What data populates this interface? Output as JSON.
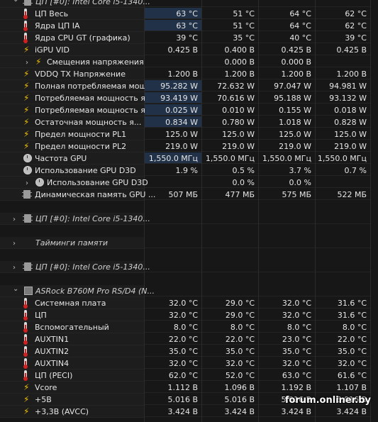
{
  "rows": [
    {
      "kind": "sensor",
      "indent": 0,
      "icon": "chip-icon",
      "name": "ЦП [#0]: Intel Core i5-1340...",
      "v": [
        "",
        "",
        "",
        ""
      ],
      "hl": [
        false,
        false,
        false,
        false
      ],
      "italic": true,
      "partial": true
    },
    {
      "kind": "sensor",
      "indent": 1,
      "icon": "thermometer-icon",
      "name": "ЦП Весь",
      "v": [
        "63 °C",
        "51 °C",
        "64 °C",
        "62 °C"
      ],
      "hl": [
        true,
        false,
        false,
        false
      ]
    },
    {
      "kind": "sensor",
      "indent": 1,
      "icon": "thermometer-icon",
      "name": "Ядра ЦП IA",
      "v": [
        "63 °C",
        "51 °C",
        "64 °C",
        "62 °C"
      ],
      "hl": [
        true,
        false,
        false,
        false
      ]
    },
    {
      "kind": "sensor",
      "indent": 1,
      "icon": "thermometer-icon",
      "name": "Ядра CPU GT (графика)",
      "v": [
        "39 °C",
        "35 °C",
        "40 °C",
        "39 °C"
      ],
      "hl": [
        false,
        false,
        false,
        false
      ]
    },
    {
      "kind": "sensor",
      "indent": 1,
      "icon": "bolt-icon",
      "name": "iGPU VID",
      "v": [
        "0.425 В",
        "0.400 В",
        "0.425 В",
        "0.425 В"
      ],
      "hl": [
        false,
        false,
        false,
        false
      ]
    },
    {
      "kind": "sensor",
      "indent": 2,
      "icon": "bolt-icon",
      "chev": true,
      "name": "Смещения напряжения",
      "v": [
        "",
        "0.000 В",
        "0.000 В",
        ""
      ],
      "hl": [
        false,
        false,
        false,
        false
      ]
    },
    {
      "kind": "sensor",
      "indent": 1,
      "icon": "bolt-icon",
      "name": "VDDQ TX Напряжение",
      "v": [
        "1.200 В",
        "1.200 В",
        "1.200 В",
        "1.200 В"
      ],
      "hl": [
        false,
        false,
        false,
        false
      ]
    },
    {
      "kind": "sensor",
      "indent": 1,
      "icon": "bolt-icon",
      "name": "Полная потребляемая мощ...",
      "v": [
        "95.282 W",
        "72.632 W",
        "97.047 W",
        "94.981 W"
      ],
      "hl": [
        true,
        false,
        false,
        false
      ]
    },
    {
      "kind": "sensor",
      "indent": 1,
      "icon": "bolt-icon",
      "name": "Потребляемая мощность я...",
      "v": [
        "93.419 W",
        "70.616 W",
        "95.188 W",
        "93.132 W"
      ],
      "hl": [
        true,
        false,
        false,
        false
      ]
    },
    {
      "kind": "sensor",
      "indent": 1,
      "icon": "bolt-icon",
      "name": "Потребляемая мощность я...",
      "v": [
        "0.025 W",
        "0.010 W",
        "0.155 W",
        "0.018 W"
      ],
      "hl": [
        true,
        false,
        false,
        false
      ]
    },
    {
      "kind": "sensor",
      "indent": 1,
      "icon": "bolt-icon",
      "name": "Остаточная мощность я...",
      "v": [
        "0.834 W",
        "0.780 W",
        "1.018 W",
        "0.828 W"
      ],
      "hl": [
        true,
        false,
        false,
        false
      ]
    },
    {
      "kind": "sensor",
      "indent": 1,
      "icon": "bolt-icon",
      "name": "Предел мощности PL1",
      "v": [
        "125.0 W",
        "125.0 W",
        "125.0 W",
        "125.0 W"
      ],
      "hl": [
        false,
        false,
        false,
        false
      ]
    },
    {
      "kind": "sensor",
      "indent": 1,
      "icon": "bolt-icon",
      "name": "Предел мощности PL2",
      "v": [
        "219.0 W",
        "219.0 W",
        "219.0 W",
        "219.0 W"
      ],
      "hl": [
        false,
        false,
        false,
        false
      ]
    },
    {
      "kind": "sensor",
      "indent": 1,
      "icon": "clock-icon",
      "name": "Частота GPU",
      "v": [
        "1,550.0 МГц",
        "1,550.0 МГц",
        "1,550.0 МГц",
        "1,550.0 МГц"
      ],
      "hl": [
        true,
        false,
        false,
        false
      ]
    },
    {
      "kind": "sensor",
      "indent": 1,
      "icon": "clock-icon",
      "name": "Использование GPU D3D",
      "v": [
        "1.9 %",
        "0.5 %",
        "3.7 %",
        "0.7 %"
      ],
      "hl": [
        false,
        false,
        false,
        false
      ]
    },
    {
      "kind": "sensor",
      "indent": 2,
      "icon": "clock-icon",
      "chev": true,
      "name": "Использование GPU D3D",
      "v": [
        "",
        "0.0 %",
        "0.0 %",
        ""
      ],
      "hl": [
        false,
        false,
        false,
        false
      ]
    },
    {
      "kind": "sensor",
      "indent": 1,
      "icon": "chip-icon",
      "name": "Динамическая память GPU ...",
      "v": [
        "507 МБ",
        "477 МБ",
        "575 МБ",
        "522 МБ"
      ],
      "hl": [
        false,
        false,
        false,
        false
      ]
    },
    {
      "kind": "empty"
    },
    {
      "kind": "group",
      "icon": "chip-icon",
      "name": "ЦП [#0]: Intel Core i5-1340..."
    },
    {
      "kind": "empty"
    },
    {
      "kind": "group",
      "icon": "",
      "name": "Тайминги памяти"
    },
    {
      "kind": "empty"
    },
    {
      "kind": "group",
      "icon": "chip-icon",
      "name": "ЦП [#0]: Intel Core i5-1340..."
    },
    {
      "kind": "empty"
    },
    {
      "kind": "group",
      "icon": "board-icon",
      "name": "ASRock B760M Pro RS/D4 (N...",
      "open": true
    },
    {
      "kind": "sensor",
      "indent": 1,
      "icon": "thermometer-icon",
      "name": "Системная плата",
      "v": [
        "32.0 °C",
        "29.0 °C",
        "32.0 °C",
        "31.6 °C"
      ],
      "hl": [
        false,
        false,
        false,
        false
      ]
    },
    {
      "kind": "sensor",
      "indent": 1,
      "icon": "thermometer-icon",
      "name": "ЦП",
      "v": [
        "32.0 °C",
        "29.0 °C",
        "32.0 °C",
        "31.6 °C"
      ],
      "hl": [
        false,
        false,
        false,
        false
      ]
    },
    {
      "kind": "sensor",
      "indent": 1,
      "icon": "thermometer-icon",
      "name": "Вспомогательный",
      "v": [
        "8.0 °C",
        "8.0 °C",
        "8.0 °C",
        "8.0 °C"
      ],
      "hl": [
        false,
        false,
        false,
        false
      ]
    },
    {
      "kind": "sensor",
      "indent": 1,
      "icon": "thermometer-icon",
      "name": "AUXTIN1",
      "v": [
        "22.0 °C",
        "22.0 °C",
        "23.0 °C",
        "22.0 °C"
      ],
      "hl": [
        false,
        false,
        false,
        false
      ]
    },
    {
      "kind": "sensor",
      "indent": 1,
      "icon": "thermometer-icon",
      "name": "AUXTIN2",
      "v": [
        "35.0 °C",
        "35.0 °C",
        "35.0 °C",
        "35.0 °C"
      ],
      "hl": [
        false,
        false,
        false,
        false
      ]
    },
    {
      "kind": "sensor",
      "indent": 1,
      "icon": "thermometer-icon",
      "name": "AUXTIN4",
      "v": [
        "32.0 °C",
        "32.0 °C",
        "32.0 °C",
        "32.0 °C"
      ],
      "hl": [
        false,
        false,
        false,
        false
      ]
    },
    {
      "kind": "sensor",
      "indent": 1,
      "icon": "thermometer-icon",
      "name": "ЦП (PECI)",
      "v": [
        "62.0 °C",
        "52.0 °C",
        "63.0 °C",
        "61.6 °C"
      ],
      "hl": [
        false,
        false,
        false,
        false
      ]
    },
    {
      "kind": "sensor",
      "indent": 1,
      "icon": "bolt-icon",
      "name": "Vcore",
      "v": [
        "1.112 В",
        "1.096 В",
        "1.192 В",
        "1.107 В"
      ],
      "hl": [
        false,
        false,
        false,
        false
      ]
    },
    {
      "kind": "sensor",
      "indent": 1,
      "icon": "bolt-icon",
      "name": "+5В",
      "v": [
        "5.016 В",
        "5.016 В",
        "5.016 В",
        "5.016 В"
      ],
      "hl": [
        false,
        false,
        false,
        false
      ]
    },
    {
      "kind": "sensor",
      "indent": 1,
      "icon": "bolt-icon",
      "name": "+3,3В (AVCC)",
      "v": [
        "3.424 В",
        "3.424 В",
        "3.424 В",
        "3.424 В"
      ],
      "hl": [
        false,
        false,
        false,
        false
      ]
    }
  ],
  "watermark": "forum.onliner.by",
  "colors": {
    "highlight": "#203148",
    "bolt": "#f2c200",
    "therm": "#d02020"
  }
}
